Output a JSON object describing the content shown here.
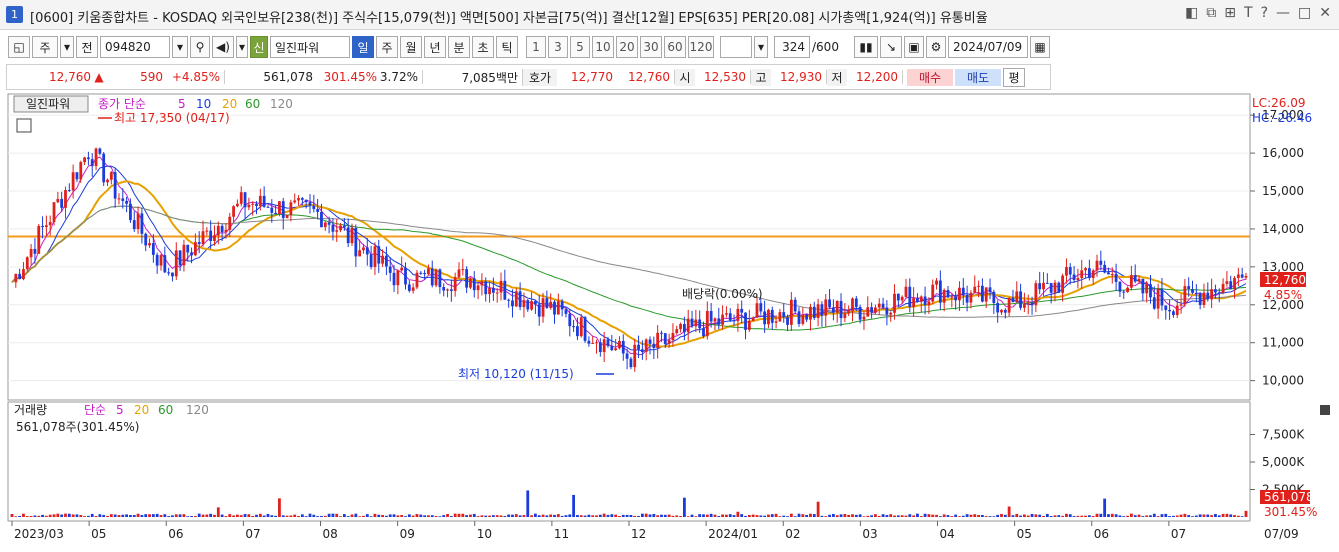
{
  "window": {
    "num": "1",
    "title": "[0600] 키움종합차트 - KOSDAQ 외국인보유[238(천)] 주식수[15,079(천)] 액면[500] 자본금[75(억)] 결산[12월] EPS[635] PER[20.08] 시가총액[1,924(억)] 유통비율",
    "controls": [
      "◧",
      "⧉",
      "⊞",
      "T",
      "?",
      "—",
      "□",
      "✕"
    ]
  },
  "toolbar": {
    "period": "주",
    "price_type": "전",
    "code": "094820",
    "sin": "신",
    "name": "일진파워",
    "tabs": [
      "일",
      "주",
      "월",
      "년",
      "분",
      "초",
      "틱"
    ],
    "active_tab": "일",
    "intervals": [
      "1",
      "3",
      "5",
      "10",
      "20",
      "30",
      "60",
      "120"
    ],
    "count": "324",
    "total": "/600",
    "date": "2024/07/09"
  },
  "quote": {
    "price": "12,760",
    "arrow": "▲",
    "change": "590",
    "pct": "+4.85%",
    "volume": "561,078",
    "vol_ratio": "301.45%",
    "turnover": "3.72%",
    "amount": "7,085백만",
    "hoga_label": "호가",
    "ask": "12,770",
    "bid": "12,760",
    "open_label": "시",
    "open": "12,530",
    "high_label": "고",
    "high": "12,930",
    "low_label": "저",
    "low": "12,200",
    "buy": "매수",
    "sell": "매도",
    "eval": "평"
  },
  "price_panel": {
    "title": "일진파워",
    "legend": [
      "종가 단순",
      "5",
      "10",
      "20",
      "60",
      "120"
    ],
    "lc": "LC:26.09",
    "hc": "HC:-26.46",
    "high_note": "최고 17,350 (04/17)",
    "low_note": "최저 10,120 (11/15)",
    "dividend": "배당락(0.00%)",
    "last_price": "12,760",
    "last_pct": "4.85%",
    "ylabels": [
      "17,000",
      "16,000",
      "15,000",
      "14,000",
      "13,000",
      "12,000",
      "11,000",
      "10,000"
    ]
  },
  "volume_panel": {
    "title": "거래량",
    "legend": [
      "단순",
      "5",
      "20",
      "60",
      "120"
    ],
    "info": "561,078주(301.45%)",
    "ylabels": [
      "7,500K",
      "5,000K",
      "2,500K"
    ],
    "last_vol": "561,078",
    "last_pct": "301.45%"
  },
  "xaxis": {
    "labels": [
      "2023/03",
      "05",
      "06",
      "07",
      "08",
      "09",
      "10",
      "11",
      "12",
      "2024/01",
      "02",
      "03",
      "04",
      "05",
      "06",
      "07",
      "07/09"
    ]
  },
  "chart_data": {
    "type": "candlestick",
    "period": "daily",
    "x_range": [
      "2023/03",
      "2024/07/09"
    ],
    "y_range": [
      9700,
      17400
    ],
    "monthly_close": [
      {
        "x": "2023/03",
        "y": 12600
      },
      {
        "x": "2023/04",
        "y": 16100
      },
      {
        "x": "2023/05",
        "y": 12900
      },
      {
        "x": "2023/06",
        "y": 14700
      },
      {
        "x": "2023/07",
        "y": 14400
      },
      {
        "x": "2023/08",
        "y": 12700
      },
      {
        "x": "2023/09",
        "y": 12700
      },
      {
        "x": "2023/10",
        "y": 11900
      },
      {
        "x": "2023/11",
        "y": 10600
      },
      {
        "x": "2023/12",
        "y": 11500
      },
      {
        "x": "2024/01",
        "y": 11800
      },
      {
        "x": "2024/02",
        "y": 11900
      },
      {
        "x": "2024/03",
        "y": 12400
      },
      {
        "x": "2024/04",
        "y": 12000
      },
      {
        "x": "2024/05",
        "y": 13000
      },
      {
        "x": "2024/06",
        "y": 12000
      },
      {
        "x": "2024/07",
        "y": 12760
      }
    ],
    "ref_line": 13800,
    "high": {
      "value": 17350,
      "date": "04/17"
    },
    "low": {
      "value": 10120,
      "date": "11/15"
    },
    "last": 12760,
    "last_volume": 561078
  }
}
